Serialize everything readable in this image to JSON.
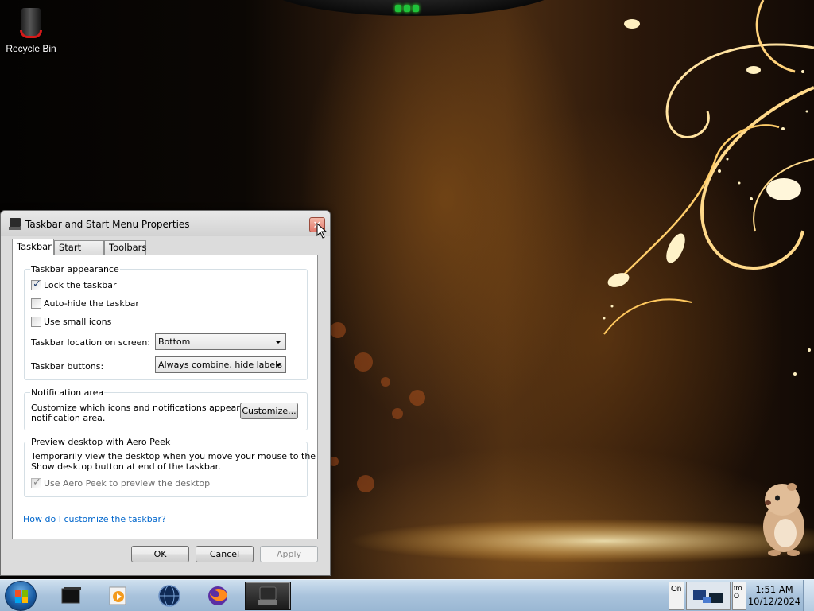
{
  "desktop": {
    "icons": [
      {
        "label": "Recycle Bin",
        "icon": "recycle-bin-icon"
      }
    ]
  },
  "dialog": {
    "title": "Taskbar and Start Menu Properties",
    "close_glyph": "✕",
    "tabs": [
      {
        "label": "Taskbar",
        "active": true
      },
      {
        "label": "Start Menu",
        "active": false
      },
      {
        "label": "Toolbars",
        "active": false
      }
    ],
    "appearance": {
      "title": "Taskbar appearance",
      "lock_label": "Lock the taskbar",
      "lock_checked": true,
      "autohide_label": "Auto-hide the taskbar",
      "autohide_checked": false,
      "small_icons_label": "Use small icons",
      "small_icons_checked": false,
      "location_label": "Taskbar location on screen:",
      "location_value": "Bottom",
      "buttons_label": "Taskbar buttons:",
      "buttons_value": "Always combine, hide labels"
    },
    "notification": {
      "title": "Notification area",
      "text_line1": "Customize which icons and notifications appear in the",
      "text_line2": "notification area.",
      "customize_button": "Customize..."
    },
    "aero_peek": {
      "title": "Preview desktop with Aero Peek",
      "text_line1": "Temporarily view the desktop when you move your mouse to the",
      "text_line2": "Show desktop button at end of the taskbar.",
      "use_label": "Use Aero Peek to preview the desktop",
      "use_checked": true
    },
    "help_link": "How do I customize the taskbar?",
    "ok_button": "OK",
    "cancel_button": "Cancel",
    "apply_button": "Apply"
  },
  "taskbar": {
    "pinned": [
      {
        "name": "black-box-app-icon"
      },
      {
        "name": "media-player-icon"
      },
      {
        "name": "globe-app-icon"
      },
      {
        "name": "firefox-icon"
      },
      {
        "name": "taskbar-properties-icon",
        "active": true
      }
    ],
    "tray": {
      "block1_text": "On",
      "block2_text": "tro\nO"
    },
    "clock": {
      "time": "1:51 AM",
      "date": "10/12/2024"
    }
  },
  "colors": {
    "link": "#0066cc",
    "taskbar": "#a9c3dc",
    "dialog_bg": "#dcdcdc"
  }
}
